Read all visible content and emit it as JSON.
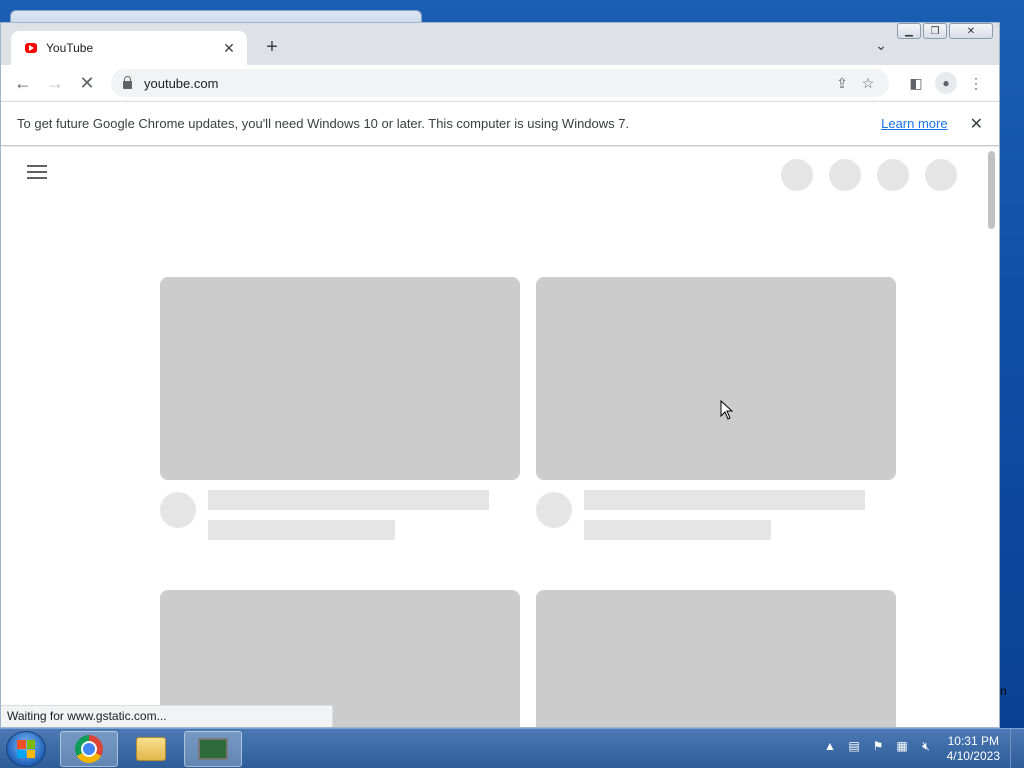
{
  "browser": {
    "tab": {
      "title": "YouTube"
    },
    "omnibox": {
      "url": "youtube.com"
    },
    "infobar": {
      "message": "To get future Google Chrome updates, you'll need Windows 10 or later. This computer is using Windows 7.",
      "link_label": "Learn more"
    },
    "status": "Waiting for www.gstatic.com..."
  },
  "page": {
    "state": "loading-skeleton"
  },
  "taskbar": {
    "items": [
      "start",
      "chrome",
      "windows-explorer",
      "network-monitor"
    ],
    "clock": {
      "time": "10:31 PM",
      "date": "4/10/2023"
    }
  },
  "colors": {
    "skeleton_dark": "#cccccc",
    "skeleton_light": "#e5e5e5",
    "link": "#1a73e8",
    "youtube_red": "#ff0000"
  }
}
